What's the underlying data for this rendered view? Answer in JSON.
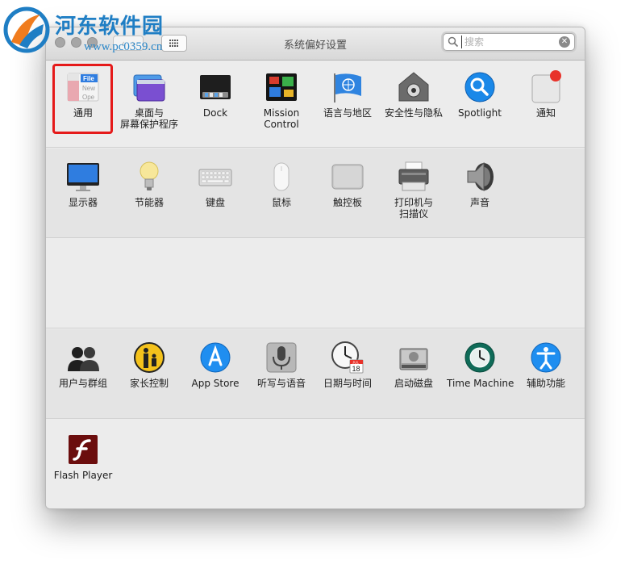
{
  "watermark": {
    "title": "河东软件园",
    "url": "www.pc0359.cn"
  },
  "window": {
    "title": "系统偏好设置"
  },
  "search": {
    "value": "",
    "placeholder": "搜索"
  },
  "sections": [
    [
      {
        "label_lines": [
          "通用"
        ],
        "icon": "general-icon",
        "selected": true
      },
      {
        "label_lines": [
          "桌面与",
          "屏幕保护程序"
        ],
        "icon": "desktop-screensaver-icon"
      },
      {
        "label_lines": [
          "Dock"
        ],
        "icon": "dock-icon"
      },
      {
        "label_lines": [
          "Mission",
          "Control"
        ],
        "icon": "mission-control-icon"
      },
      {
        "label_lines": [
          "语言与地区"
        ],
        "icon": "language-region-icon"
      },
      {
        "label_lines": [
          "安全性与隐私"
        ],
        "icon": "security-privacy-icon"
      },
      {
        "label_lines": [
          "Spotlight"
        ],
        "icon": "spotlight-icon"
      },
      {
        "label_lines": [
          "通知"
        ],
        "icon": "notifications-icon"
      }
    ],
    [
      {
        "label_lines": [
          "显示器"
        ],
        "icon": "displays-icon"
      },
      {
        "label_lines": [
          "节能器"
        ],
        "icon": "energy-saver-icon"
      },
      {
        "label_lines": [
          "键盘"
        ],
        "icon": "keyboard-icon"
      },
      {
        "label_lines": [
          "鼠标"
        ],
        "icon": "mouse-icon"
      },
      {
        "label_lines": [
          "触控板"
        ],
        "icon": "trackpad-icon"
      },
      {
        "label_lines": [
          "打印机与",
          "扫描仪"
        ],
        "icon": "printer-scanner-icon"
      },
      {
        "label_lines": [
          "声音"
        ],
        "icon": "sound-icon"
      }
    ],
    [],
    [
      {
        "label_lines": [
          "用户与群组"
        ],
        "icon": "users-groups-icon"
      },
      {
        "label_lines": [
          "家长控制"
        ],
        "icon": "parental-controls-icon"
      },
      {
        "label_lines": [
          "App Store"
        ],
        "icon": "app-store-icon"
      },
      {
        "label_lines": [
          "听写与语音"
        ],
        "icon": "dictation-speech-icon"
      },
      {
        "label_lines": [
          "日期与时间"
        ],
        "icon": "date-time-icon"
      },
      {
        "label_lines": [
          "启动磁盘"
        ],
        "icon": "startup-disk-icon"
      },
      {
        "label_lines": [
          "Time Machine"
        ],
        "icon": "time-machine-icon"
      },
      {
        "label_lines": [
          "辅助功能"
        ],
        "icon": "accessibility-icon"
      }
    ],
    [
      {
        "label_lines": [
          "Flash Player"
        ],
        "icon": "flash-player-icon"
      }
    ]
  ],
  "general_icon": {
    "tab_label": "File",
    "lines": [
      "New",
      "Ope"
    ]
  },
  "date_icon": {
    "month": "JUL",
    "day": "18"
  },
  "colors": {
    "highlight": "#e51a1a",
    "watermark": "#1f7ec4",
    "accent": "#1a88e8"
  }
}
